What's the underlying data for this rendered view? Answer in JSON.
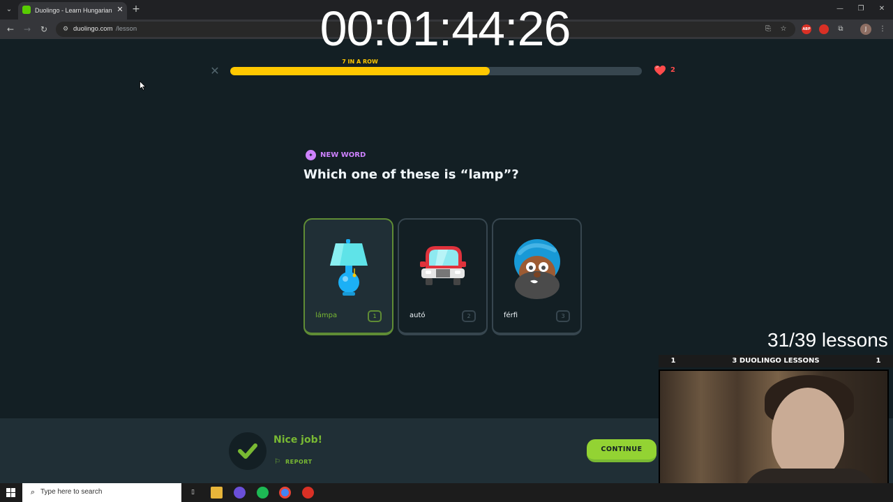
{
  "browser": {
    "tab_title": "Duolingo - Learn Hungarian wit",
    "tab_close": "✕",
    "new_tab": "+",
    "url_host": "duolingo.com",
    "url_path": "/lesson",
    "window_controls": [
      "—",
      "❐",
      "✕"
    ],
    "extension_label": "ABP",
    "profile_initial": "J"
  },
  "overlay": {
    "timer": "00:01:44:26",
    "lessons_count": "31/39 lessons",
    "goal": {
      "left": "1",
      "title": "3 DUOLINGO LESSONS",
      "right": "1"
    }
  },
  "lesson": {
    "close_icon": "✕",
    "streak_label": "7 IN A ROW",
    "progress": 0.63,
    "hearts": "2",
    "badge": "NEW WORD",
    "question": "Which one of these is “lamp”?",
    "choices": [
      {
        "label": "lámpa",
        "key": "1",
        "selected": true,
        "icon": "lamp-icon"
      },
      {
        "label": "autó",
        "key": "2",
        "selected": false,
        "icon": "car-icon"
      },
      {
        "label": "férfi",
        "key": "3",
        "selected": false,
        "icon": "man-icon"
      }
    ]
  },
  "feedback": {
    "message": "Nice job!",
    "report": "REPORT",
    "continue": "CONTINUE"
  },
  "taskbar": {
    "search_placeholder": "Type here to search"
  },
  "colors": {
    "background": "#131f24",
    "streak_yellow": "#ffc800",
    "correct_green": "#79b933",
    "continue_green": "#93d333",
    "new_word_purple": "#ce82ff",
    "heart_red": "#ff4b4b"
  }
}
